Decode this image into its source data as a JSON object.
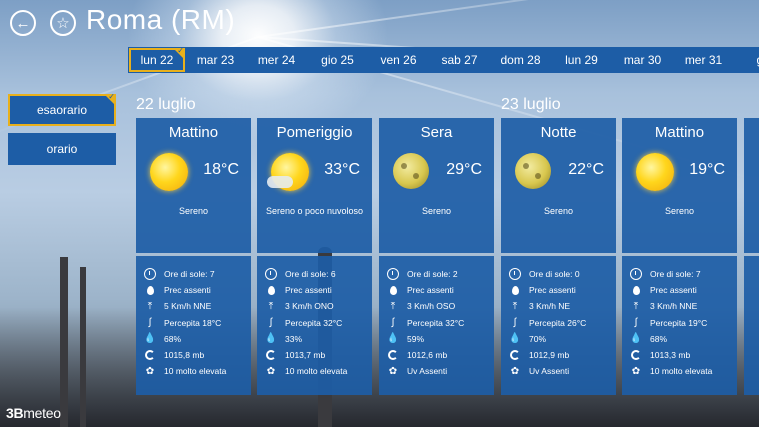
{
  "header": {
    "title": "Roma (RM)",
    "back_icon": "arrow-left-icon",
    "favorite_icon": "star-icon"
  },
  "dates": [
    {
      "label": "lun 22",
      "selected": true
    },
    {
      "label": "mar 23"
    },
    {
      "label": "mer 24"
    },
    {
      "label": "gio 25"
    },
    {
      "label": "ven 26"
    },
    {
      "label": "sab 27"
    },
    {
      "label": "dom 28"
    },
    {
      "label": "lun 29"
    },
    {
      "label": "mar 30"
    },
    {
      "label": "mer 31"
    },
    {
      "label": "gio"
    }
  ],
  "view_toggle": {
    "esaorario": "esaorario",
    "orario": "orario"
  },
  "day_headers": [
    "22 luglio",
    "23 luglio"
  ],
  "cards": [
    {
      "period": "Mattino",
      "icon": "sun-icon",
      "temp": "18°C",
      "desc": "Sereno",
      "details": [
        "Ore di sole: 7",
        "Prec assenti",
        "5 Km/h NNE",
        "Percepita 18°C",
        "68%",
        "1015,8 mb",
        "10 molto elevata"
      ]
    },
    {
      "period": "Pomeriggio",
      "icon": "sun-cloud-icon",
      "temp": "33°C",
      "desc": "Sereno o poco nuvoloso",
      "details": [
        "Ore di sole: 6",
        "Prec assenti",
        "3 Km/h ONO",
        "Percepita 32°C",
        "33%",
        "1013,7 mb",
        "10 molto elevata"
      ]
    },
    {
      "period": "Sera",
      "icon": "moon-icon",
      "temp": "29°C",
      "desc": "Sereno",
      "details": [
        "Ore di sole: 2",
        "Prec assenti",
        "3 Km/h OSO",
        "Percepita 32°C",
        "59%",
        "1012,6 mb",
        "Uv Assenti"
      ]
    },
    {
      "period": "Notte",
      "icon": "moon-icon",
      "temp": "22°C",
      "desc": "Sereno",
      "details": [
        "Ore di sole: 0",
        "Prec assenti",
        "3 Km/h NE",
        "Percepita 26°C",
        "70%",
        "1012,9 mb",
        "Uv Assenti"
      ]
    },
    {
      "period": "Mattino",
      "icon": "sun-icon",
      "temp": "19°C",
      "desc": "Sereno",
      "details": [
        "Ore di sole: 7",
        "Prec assenti",
        "3 Km/h NNE",
        "Percepita 19°C",
        "68%",
        "1013,3 mb",
        "10 molto elevata"
      ]
    }
  ],
  "detail_icons": [
    "clock-icon",
    "drop-icon",
    "wind-icon",
    "thermometer-icon",
    "humidity-icon",
    "pressure-icon",
    "uv-icon"
  ],
  "brand": {
    "prefix": "3B",
    "name": "meteo"
  },
  "colors": {
    "accent": "#1d5da6",
    "selection": "#e8b01c"
  }
}
